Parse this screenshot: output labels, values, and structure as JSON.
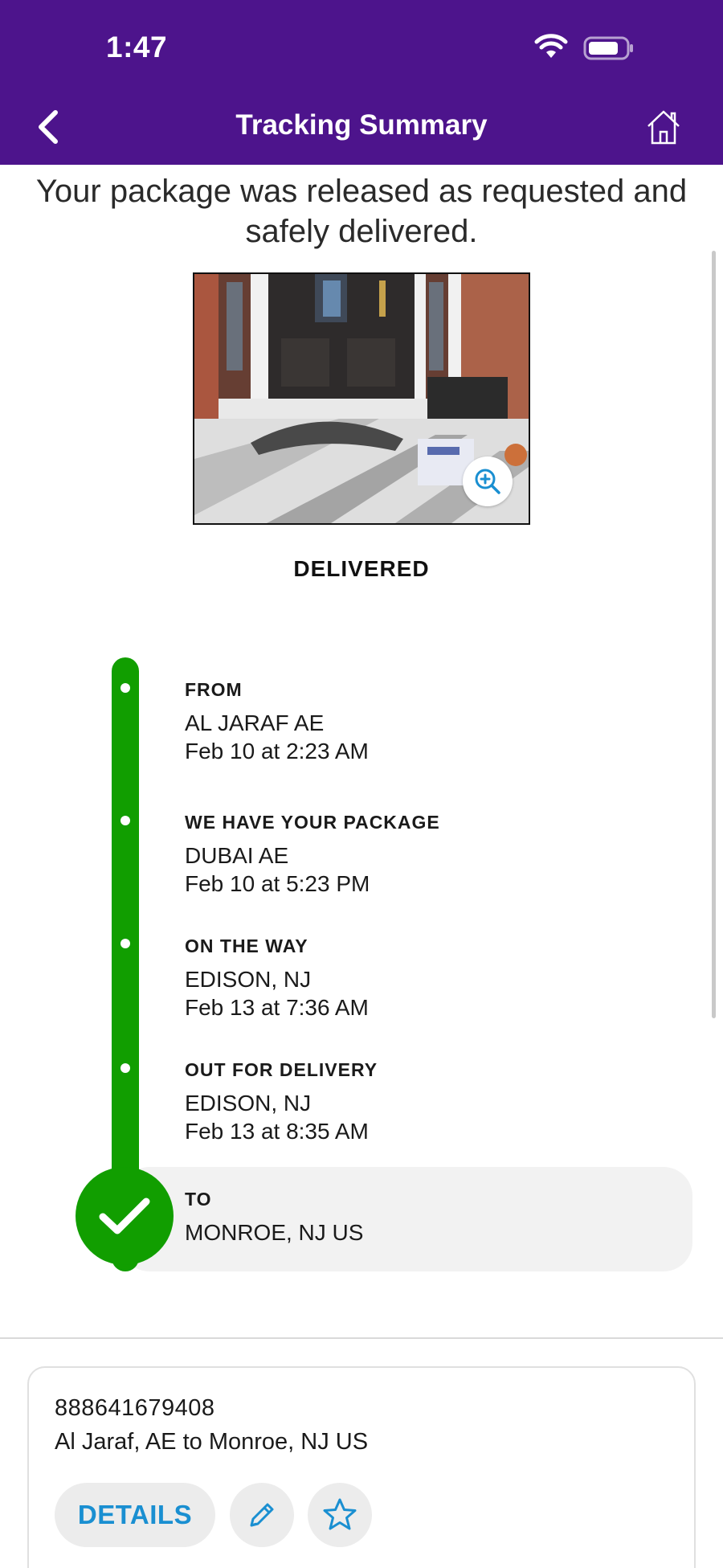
{
  "status_bar": {
    "time": "1:47"
  },
  "header": {
    "title": "Tracking Summary",
    "back_icon": "chevron-left-icon",
    "home_icon": "home-icon"
  },
  "colors": {
    "brand_purple": "#4d148c",
    "success_green": "#119e00",
    "link_blue": "#1a8fd1"
  },
  "message": "Your package was released as requested and safely delivered.",
  "photo": {
    "zoom_icon": "zoom-in-icon"
  },
  "status_label": "DELIVERED",
  "timeline": {
    "events": [
      {
        "title": "FROM",
        "location": "AL JARAF AE",
        "time": "Feb 10 at 2:23 AM"
      },
      {
        "title": "WE HAVE YOUR PACKAGE",
        "location": "DUBAI AE",
        "time": "Feb 10 at 5:23 PM"
      },
      {
        "title": "ON THE WAY",
        "location": "EDISON, NJ",
        "time": "Feb 13 at 7:36 AM"
      },
      {
        "title": "OUT FOR DELIVERY",
        "location": "EDISON, NJ",
        "time": "Feb 13 at 8:35 AM"
      }
    ],
    "destination": {
      "title": "TO",
      "location": "MONROE, NJ  US"
    }
  },
  "card": {
    "tracking_number": "888641679408",
    "route": "Al Jaraf, AE to Monroe, NJ US",
    "details_label": "DETAILS",
    "edit_icon": "pencil-icon",
    "favorite_icon": "star-icon"
  }
}
